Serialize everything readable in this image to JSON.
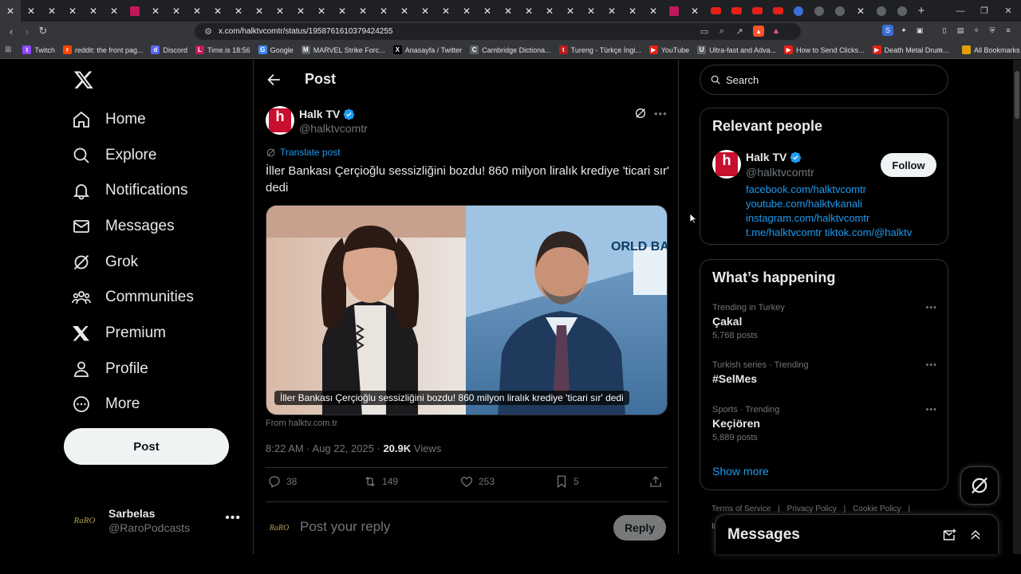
{
  "browser": {
    "url": "x.com/halktvcomtr/status/1958761610379424255",
    "bookmarks": [
      {
        "label": "Twitch",
        "color": "#9146ff",
        "glyph": "t"
      },
      {
        "label": "reddit: the front pag...",
        "color": "#ff4500",
        "glyph": "r"
      },
      {
        "label": "Discord",
        "color": "#5865f2",
        "glyph": "d"
      },
      {
        "label": "Time.is 18:56",
        "color": "#c2185b",
        "glyph": "L"
      },
      {
        "label": "Google",
        "color": "#4285f4",
        "glyph": "G"
      },
      {
        "label": "MARVEL Strike Forc...",
        "color": "#5f6368",
        "glyph": "M"
      },
      {
        "label": "Anasayfa / Twitter",
        "color": "#000000",
        "glyph": "X"
      },
      {
        "label": "Cambridge Dictiona...",
        "color": "#5f6368",
        "glyph": "C"
      },
      {
        "label": "Tureng - Türkçe İngi...",
        "color": "#b71c1c",
        "glyph": "t"
      },
      {
        "label": "YouTube",
        "color": "#e62117",
        "glyph": "▶"
      },
      {
        "label": "Ultra-fast and Adva...",
        "color": "#5f6368",
        "glyph": "U"
      },
      {
        "label": "How to Send Clicks...",
        "color": "#e62117",
        "glyph": "▶"
      },
      {
        "label": "Death Metal Drum...",
        "color": "#e62117",
        "glyph": "▶"
      }
    ],
    "all_bookmarks": "All Bookmarks"
  },
  "nav": {
    "items": [
      {
        "label": "Home",
        "icon": "home-icon"
      },
      {
        "label": "Explore",
        "icon": "search-icon"
      },
      {
        "label": "Notifications",
        "icon": "bell-icon"
      },
      {
        "label": "Messages",
        "icon": "mail-icon"
      },
      {
        "label": "Grok",
        "icon": "grok-icon"
      },
      {
        "label": "Communities",
        "icon": "communities-icon"
      },
      {
        "label": "Premium",
        "icon": "x-premium-icon"
      },
      {
        "label": "Profile",
        "icon": "person-icon"
      },
      {
        "label": "More",
        "icon": "more-circle-icon"
      }
    ],
    "post_button": "Post",
    "account": {
      "name": "Sarbelas",
      "handle": "@RaroPodcasts",
      "avatar_text": "RaRO"
    }
  },
  "post": {
    "header_title": "Post",
    "author_name": "Halk TV",
    "author_handle": "@halktvcomtr",
    "avatar_letter": "h",
    "translate": "Translate post",
    "text": "İller Bankası Çerçioğlu sessizliğini bozdu! 860 milyon liralık krediye 'ticari sır' dedi",
    "media_caption": "İller Bankası Çerçioğlu sessizliğini bozdu! 860 milyon liralık krediye 'ticari sır' dedi",
    "media_source": "From halktv.com.tr",
    "time": "8:22 AM · Aug 22, 2025 · ",
    "views_count": "20.9K",
    "views_label": " Views",
    "replies": "38",
    "reposts": "149",
    "likes": "253",
    "bookmarks": "5",
    "reply_placeholder": "Post your reply",
    "reply_button": "Reply",
    "reply_avatar_text": "RaRO"
  },
  "sidebar": {
    "search_placeholder": "Search",
    "relevant_title": "Relevant people",
    "person": {
      "name": "Halk TV",
      "handle": "@halktvcomtr",
      "follow": "Follow",
      "bio_lines": [
        "facebook.com/halktvcomtr",
        "youtube.com/halktvkanali",
        "instagram.com/halktvcomtr",
        "t.me/halktvcomtr tiktok.com/@halktv"
      ]
    },
    "happening_title": "What’s happening",
    "trends": [
      {
        "context": "Trending in Turkey",
        "name": "Çakal",
        "posts": "5,768 posts"
      },
      {
        "context": "Turkish series · Trending",
        "name": "#SelMes",
        "posts": ""
      },
      {
        "context": "Sports · Trending",
        "name": "Keçiören",
        "posts": "5,889 posts"
      }
    ],
    "show_more": "Show more",
    "footer": [
      "Terms of Service",
      "|",
      "Privacy Policy",
      "|",
      "Cookie Policy",
      "|"
    ],
    "footer_more": "Im"
  },
  "messages_drawer": {
    "title": "Messages"
  },
  "colors": {
    "accent": "#1d9bf0",
    "brand_red": "#c8102e",
    "verified": "#1d9bf0"
  }
}
